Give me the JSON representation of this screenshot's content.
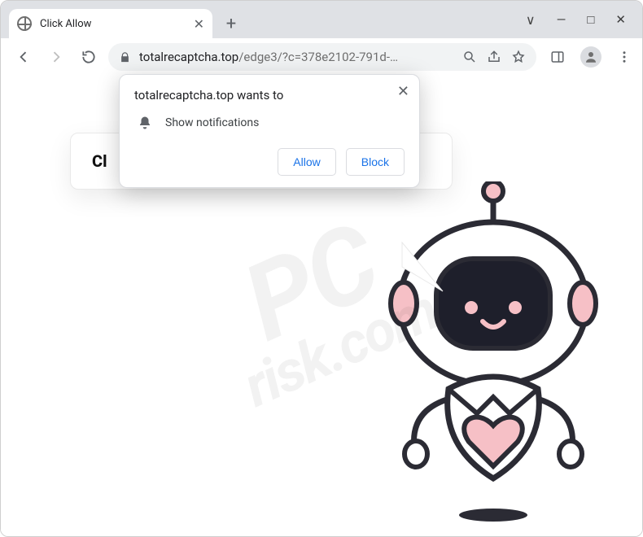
{
  "window": {
    "minimize_glyph": "—",
    "maximize_glyph": "□",
    "close_glyph": "✕",
    "dropdown_glyph": "∨"
  },
  "tab": {
    "title": "Click Allow",
    "close_glyph": "✕",
    "new_tab_glyph": "+"
  },
  "url": {
    "host": "totalrecaptcha.top",
    "path": "/edge3/?c=378e2102-791d-…"
  },
  "page": {
    "card_heading_visible": "Cl"
  },
  "permission": {
    "prompt": "totalrecaptcha.top wants to",
    "item": "Show notifications",
    "allow": "Allow",
    "block": "Block",
    "close_glyph": "✕"
  },
  "watermark": {
    "line1": "PC",
    "line2": "risk.com"
  }
}
